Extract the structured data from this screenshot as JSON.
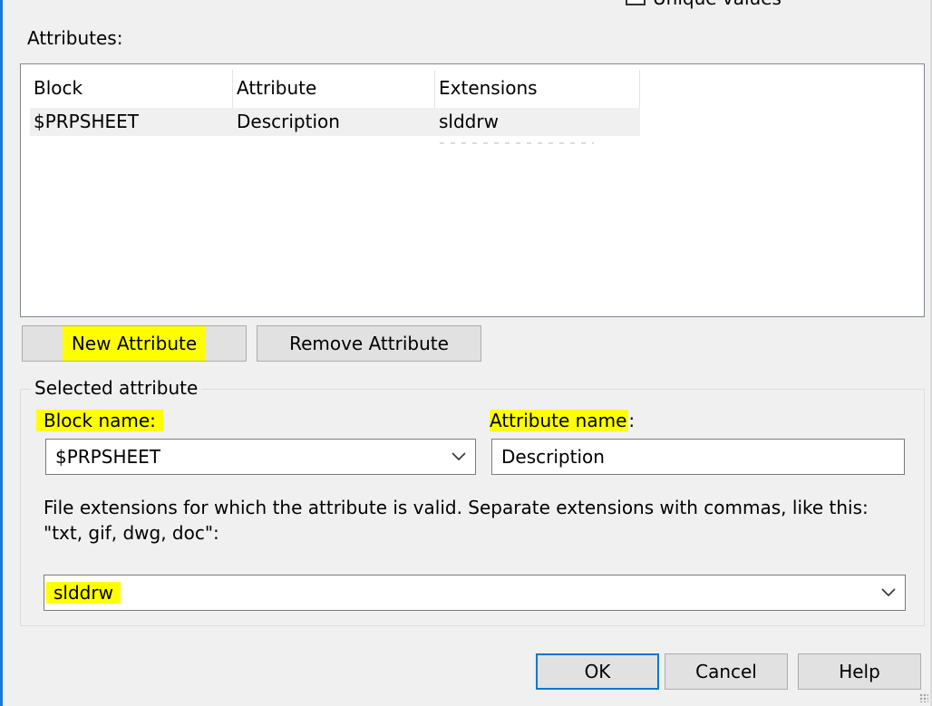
{
  "top_checkbox": {
    "label": "Unique values"
  },
  "attributes_section": {
    "label": "Attributes:"
  },
  "attribute_list": {
    "columns": [
      "Block",
      "Attribute",
      "Extensions"
    ],
    "rows": [
      {
        "block": "$PRPSHEET",
        "attribute": "Description",
        "extensions": "slddrw"
      }
    ]
  },
  "buttons": {
    "new_attribute": "New Attribute",
    "remove_attribute": "Remove Attribute",
    "ok": "OK",
    "cancel": "Cancel",
    "help": "Help"
  },
  "selected_attribute": {
    "group_label": "Selected attribute",
    "block_name_label": "Block name:",
    "block_name_value": "$PRPSHEET",
    "attribute_name_label": "Attribute name",
    "attribute_name_colon": ":",
    "attribute_name_value": "Description",
    "extensions_description": "File extensions for which the attribute is valid. Separate extensions with commas, like this: \"txt, gif, dwg, doc\":",
    "extensions_value": "slddrw"
  },
  "colors": {
    "highlight": "#ffff00",
    "dialog_bg": "#f0f0f0",
    "accent": "#0078d7"
  }
}
